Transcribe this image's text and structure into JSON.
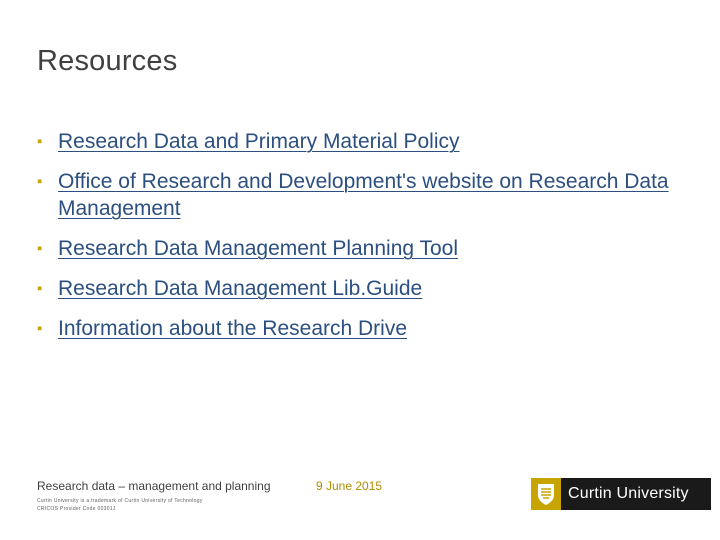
{
  "slide": {
    "title": "Resources",
    "items": [
      {
        "text": "Research Data and Primary Material Policy"
      },
      {
        "text": "Office of Research and Development's website on Research Data Management"
      },
      {
        "text": "Research Data Management Planning Tool"
      },
      {
        "text": "Research Data Management Lib.Guide"
      },
      {
        "text": "Information about the Research Drive"
      }
    ]
  },
  "footer": {
    "presentation_title": "Research data – management and planning",
    "legal_line1": "Curtin University is a trademark of Curtin University of Technology",
    "legal_line2": "CRICOS Provider Code 00301J",
    "date": "9 June 2015",
    "logo_text": "Curtin University"
  },
  "colors": {
    "bullet": "#c8a400",
    "link": "#2c4f80",
    "date": "#b08c00",
    "logo_bar": "#1a1a1a",
    "logo_crest": "#c8a400"
  },
  "icons": {
    "bullet": "square-bullet-icon",
    "logo": "curtin-crest-icon"
  }
}
